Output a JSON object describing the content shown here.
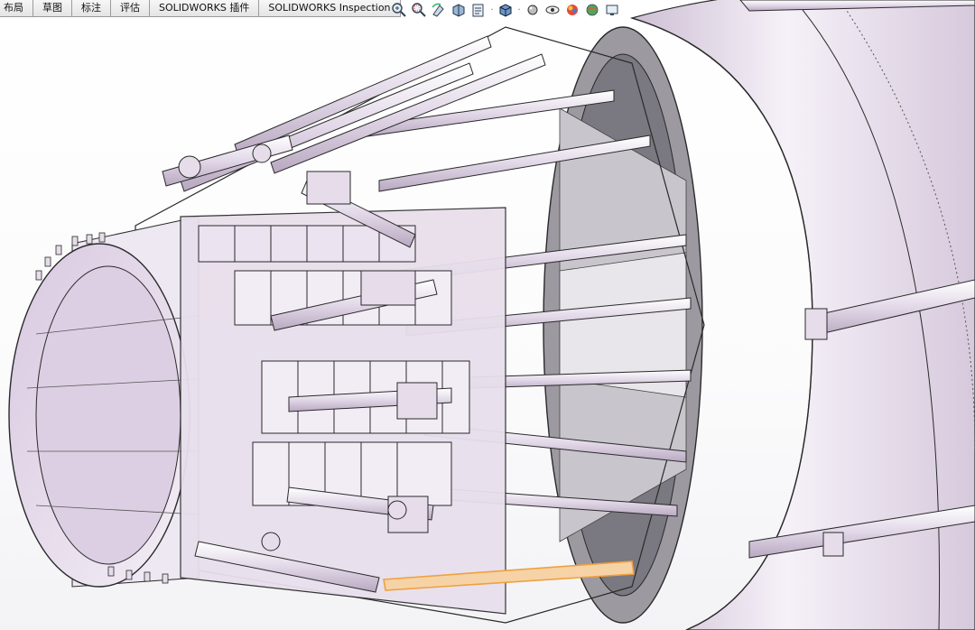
{
  "command_tabs": [
    "布局",
    "草图",
    "标注",
    "评估",
    "SOLIDWORKS 插件",
    "SOLIDWORKS Inspection"
  ],
  "heads_up_toolbar": [
    {
      "name": "zoom-to-fit-icon"
    },
    {
      "name": "zoom-to-area-icon"
    },
    {
      "name": "previous-view-icon"
    },
    {
      "name": "section-view-icon"
    },
    {
      "name": "dynamic-annotation-view-icon"
    },
    {
      "name": "view-orientation-icon"
    },
    {
      "name": "display-style-icon"
    },
    {
      "name": "hide-show-items-icon"
    },
    {
      "name": "edit-appearance-icon"
    },
    {
      "name": "apply-scene-icon"
    },
    {
      "name": "view-settings-icon"
    }
  ],
  "colors": {
    "model": "#e6dcea",
    "model_shadow": "#b9a9c2",
    "edge": "#2a2a2a",
    "selected": "#f0a040"
  }
}
